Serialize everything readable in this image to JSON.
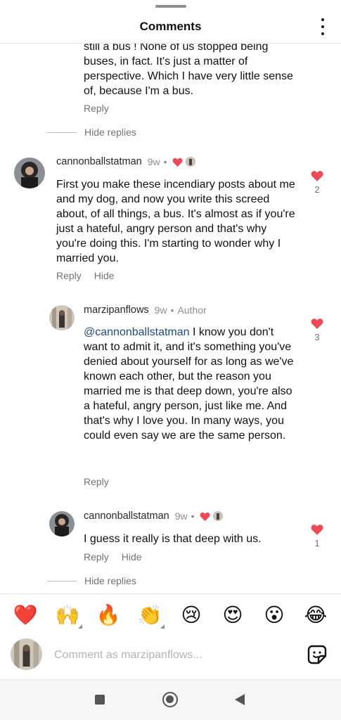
{
  "header": {
    "title": "Comments",
    "menu_icon": "more-vertical-icon"
  },
  "comments": [
    {
      "id": "prev-reply-tail",
      "text": "still a bus ! None of us stopped being buses, in fact. It's just a matter of perspective. Which I have very little sense of, because I'm a bus.",
      "reply_label": "Reply",
      "hide_replies_label": "Hide replies"
    },
    {
      "id": "c1",
      "username": "cannonballstatman",
      "time": "9w",
      "text": "First you make these incendiary posts about me and my dog, and now you write this screed about, of all things, a bus. It's almost as if you're just a hateful, angry person and that's why you're doing this. I'm starting to wonder why I married you.",
      "like_count": "2",
      "reply_label": "Reply",
      "hide_label": "Hide"
    },
    {
      "id": "c2",
      "username": "marzipanflows",
      "time": "9w",
      "author_label": "Author",
      "mention": "@cannonballstatman",
      "text": " I know you don't want to admit it, and it's something you've denied about yourself for as long as we've known each other, but the reason you married me is that deep down, you're also a hateful, angry person, just like me. And that's why I love you. In many ways, you could even say we are the same person.",
      "like_count": "3",
      "reply_label": "Reply"
    },
    {
      "id": "c3",
      "username": "cannonballstatman",
      "time": "9w",
      "text": "I guess it really is that deep with us.",
      "like_count": "1",
      "reply_label": "Reply",
      "hide_label": "Hide",
      "hide_replies_label": "Hide replies"
    }
  ],
  "emoji_bar": [
    "❤️",
    "🙌",
    "🔥",
    "👏",
    "😢",
    "😍",
    "😮",
    "😂"
  ],
  "composer": {
    "placeholder": "Comment as marzipanflows..."
  },
  "colors": {
    "like_red": "#ed4956",
    "mention_blue": "#1f4a83",
    "meta_gray": "#8e8e8e"
  }
}
